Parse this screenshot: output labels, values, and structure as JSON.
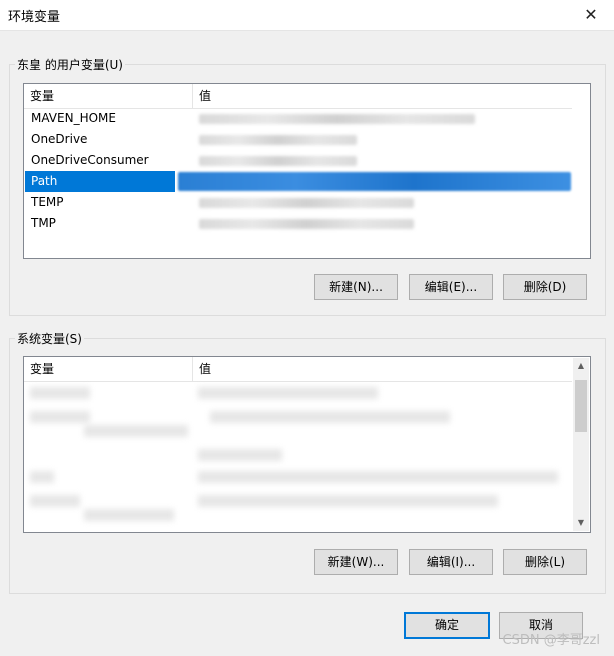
{
  "window": {
    "title": "环境变量",
    "close_glyph": "✕"
  },
  "user_vars": {
    "group_label": "东皇 的用户变量(U)",
    "col_name": "变量",
    "col_value": "值",
    "rows": [
      {
        "name": "MAVEN_HOME"
      },
      {
        "name": "OneDrive"
      },
      {
        "name": "OneDriveConsumer"
      },
      {
        "name": "Path"
      },
      {
        "name": "TEMP"
      },
      {
        "name": "TMP"
      }
    ],
    "selected_index": 3,
    "new_label": "新建(N)...",
    "edit_label": "编辑(E)...",
    "delete_label": "删除(D)"
  },
  "system_vars": {
    "group_label": "系统变量(S)",
    "col_name": "变量",
    "col_value": "值",
    "new_label": "新建(W)...",
    "edit_label": "编辑(I)...",
    "delete_label": "删除(L)"
  },
  "footer": {
    "ok_label": "确定",
    "cancel_label": "取消"
  },
  "watermark": "CSDN @李哥zzl",
  "colors": {
    "selection": "#0078d7",
    "primary_border": "#0078d7"
  }
}
